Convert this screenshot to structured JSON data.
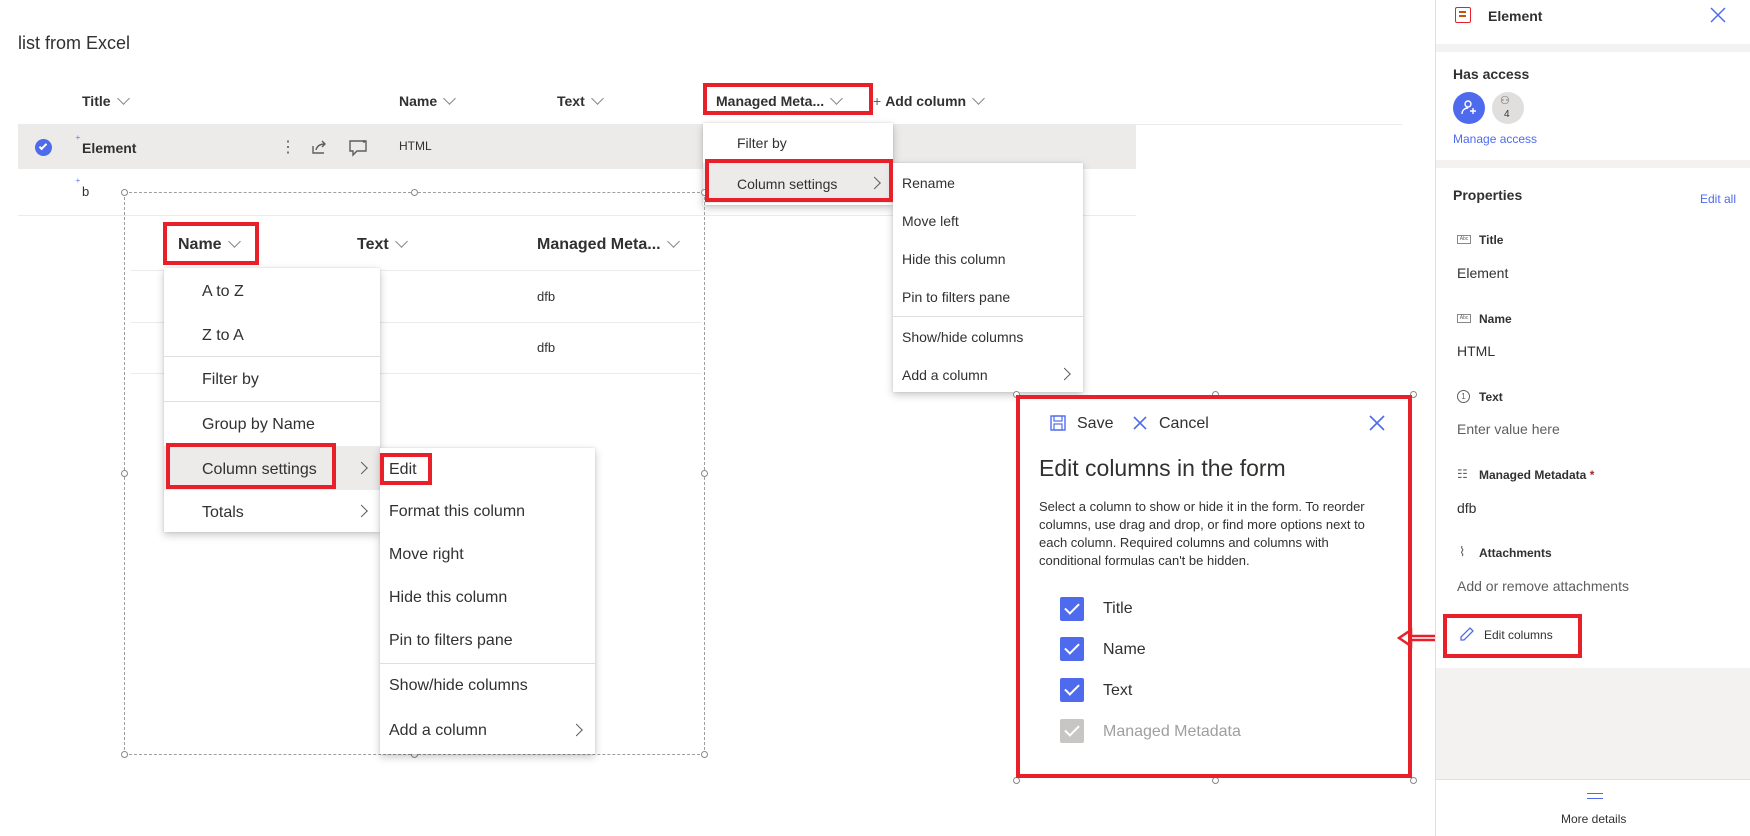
{
  "list": {
    "title": "list from Excel",
    "headers": {
      "title": "Title",
      "name": "Name",
      "text": "Text",
      "managed": "Managed Meta...",
      "add_column": "Add column"
    },
    "rows": [
      {
        "title": "Element",
        "name": "HTML"
      },
      {
        "title": "b"
      }
    ]
  },
  "managed_menu": {
    "items": [
      "Filter by",
      "Column settings"
    ],
    "submenu": [
      "Rename",
      "Move left",
      "Hide this column",
      "Pin to filters pane",
      "Show/hide columns",
      "Add a column"
    ]
  },
  "inner_list": {
    "headers": {
      "name": "Name",
      "text": "Text",
      "managed": "Managed Meta..."
    },
    "values": [
      "dfb",
      "dfb"
    ]
  },
  "name_menu": {
    "items": [
      "A to Z",
      "Z to A",
      "Filter by",
      "Group by Name",
      "Column settings",
      "Totals"
    ],
    "submenu": [
      "Edit",
      "Format this column",
      "Move right",
      "Hide this column",
      "Pin to filters pane",
      "Show/hide columns",
      "Add a column"
    ]
  },
  "edit_dialog": {
    "save": "Save",
    "cancel": "Cancel",
    "title": "Edit columns in the form",
    "description": "Select a column to show or hide it in the form. To reorder columns, use drag and drop, or find more options next to each column. Required columns and columns with conditional formulas can't be hidden.",
    "columns": [
      "Title",
      "Name",
      "Text",
      "Managed Metadata"
    ]
  },
  "panel": {
    "item_title": "Element",
    "has_access": "Has access",
    "access_count": "4",
    "manage_access": "Manage access",
    "properties": "Properties",
    "edit_all": "Edit all",
    "fields": [
      {
        "label": "Title",
        "value": "Element"
      },
      {
        "label": "Name",
        "value": "HTML"
      },
      {
        "label": "Text",
        "value": "Enter value here"
      },
      {
        "label": "Managed Metadata",
        "required": "*",
        "value": "dfb"
      },
      {
        "label": "Attachments",
        "value": "Add or remove attachments"
      }
    ],
    "edit_columns": "Edit columns",
    "more_details": "More details"
  },
  "colors": {
    "accent": "#4f6bed",
    "highlight": "#e8202a",
    "selected_row": "#edebe9"
  }
}
